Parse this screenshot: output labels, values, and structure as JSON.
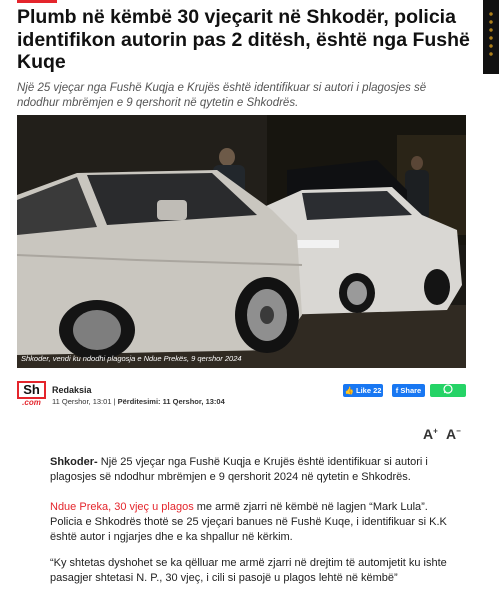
{
  "article": {
    "title": "Plumb në këmbë 30 vjeçarit në Shkodër, policia identifikon autorin pas 2 ditësh, është nga Fushë Kuqe",
    "lead": "Një 25 vjeçar nga Fushë Kuqja e Krujës është identifikuar si autori i plagosjes së ndodhur mbrëmjen e 9 qershorit në qytetin e Shkodrës.",
    "photo_caption": "Shkoder, vendi ku ndodhi plagosja e Ndue Prekës, 9 qershor 2024",
    "byline": {
      "logo_main": "Sh",
      "logo_sub": ".com",
      "author": "Redaksia",
      "published": "11 Qershor, 13:01 |",
      "updated": "Përditesimi: 11 Qershor, 13:04"
    },
    "share": {
      "like_label": "Like 22",
      "share_label": "Share",
      "whatsapp_icon": "whatsapp-icon",
      "facebook_color": "#1877f2",
      "whatsapp_color": "#25d366"
    },
    "font_controls": {
      "increase": "A",
      "decrease": "A"
    },
    "paragraphs": {
      "p1_lead": "Shkoder-",
      "p1_text": " Një 25 vjeçar nga Fushë Kuqja e Krujës është identifikuar si autori i plagosjes së ndodhur mbrëmjen e 9 qershorit 2024 në qytetin e Shkodrës.",
      "p2_link": "Ndue Preka, 30 vjeç u plagos",
      "p2_text": " me armë zjarri në këmbë në lagjen “Mark Lula”. Policia e Shkodrës thotë se 25 vjeçari banues në Fushë Kuqe, i identifikuar si K.K është autor i ngjarjes dhe e ka shpallur në kërkim.",
      "p3_text": "“Ky shtetas dyshohet se ka qëlluar me armë zjarri në drejtim të automjetit ku ishte pasagjer shtetasi N. P., 30 vjeç, i cili si pasojë u plagos lehtë në këmbë”"
    },
    "brand_color": "#e4252c"
  }
}
